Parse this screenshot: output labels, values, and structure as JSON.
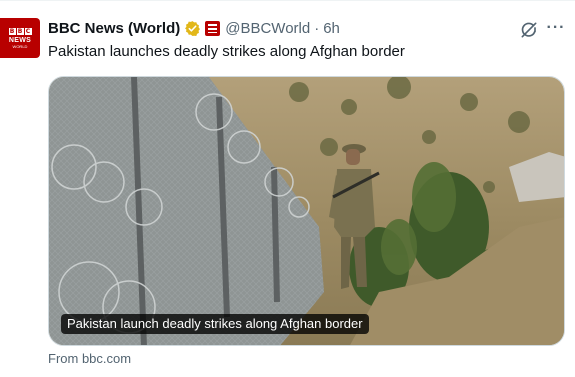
{
  "tweet": {
    "author_name": "BBC News (World)",
    "handle": "@BBCWorld",
    "separator": "·",
    "time": "6h",
    "text": "Pakistan launches deadly strikes along Afghan border",
    "verified_icon": "gold-verified-badge-icon",
    "affiliate_icon": "bbc-affiliate-badge-icon",
    "avatar_icon": "bbc-news-world-logo",
    "avatar_letters": [
      "B",
      "B",
      "C"
    ],
    "avatar_line1": "NEWS",
    "avatar_line2": "WORLD"
  },
  "actions": {
    "grok_icon": "grok-icon",
    "more_label": "···"
  },
  "media": {
    "image_subject": "soldier standing beside a border fence with razor wire on a hillside",
    "caption": "Pakistan launch deadly strikes along Afghan border"
  },
  "card": {
    "source": "From bbc.com"
  },
  "colors": {
    "bbc_red": "#b80000",
    "verified_gold": "#e2b719",
    "secondary_text": "#536471",
    "primary_text": "#0f1419"
  }
}
